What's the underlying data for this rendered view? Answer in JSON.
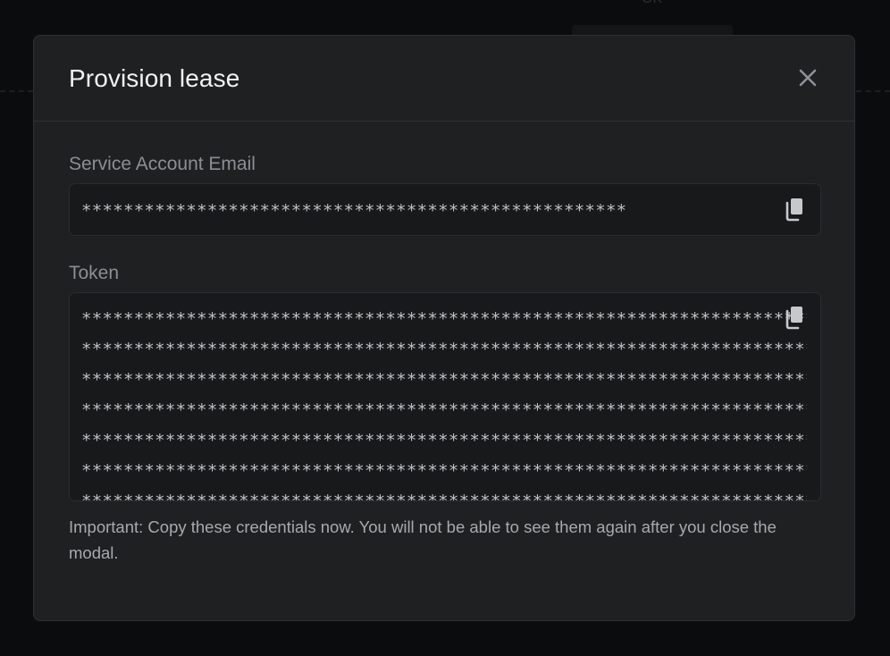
{
  "backdrop": {
    "tab_text": "OK"
  },
  "modal": {
    "title": "Provision lease",
    "close_icon": "close-icon",
    "email": {
      "label": "Service Account Email",
      "value": "****************************************************",
      "copy_icon": "copy-icon"
    },
    "token": {
      "label": "Token",
      "lines": [
        "**********************************************************************",
        "**********************************************************************",
        "**********************************************************************",
        "**********************************************************************",
        "**********************************************************************",
        "**********************************************************************",
        "**********************************************************************"
      ],
      "copy_icon": "copy-icon"
    },
    "notice": "Important: Copy these credentials now. You will not be able to see them again after you close the modal."
  },
  "colors": {
    "modal_bg": "#1f2022",
    "field_bg": "#18191b",
    "title": "#f1f2f3",
    "label": "#8b8e93",
    "masked_text": "#bfc1c4",
    "notice": "#a7a9ad"
  }
}
